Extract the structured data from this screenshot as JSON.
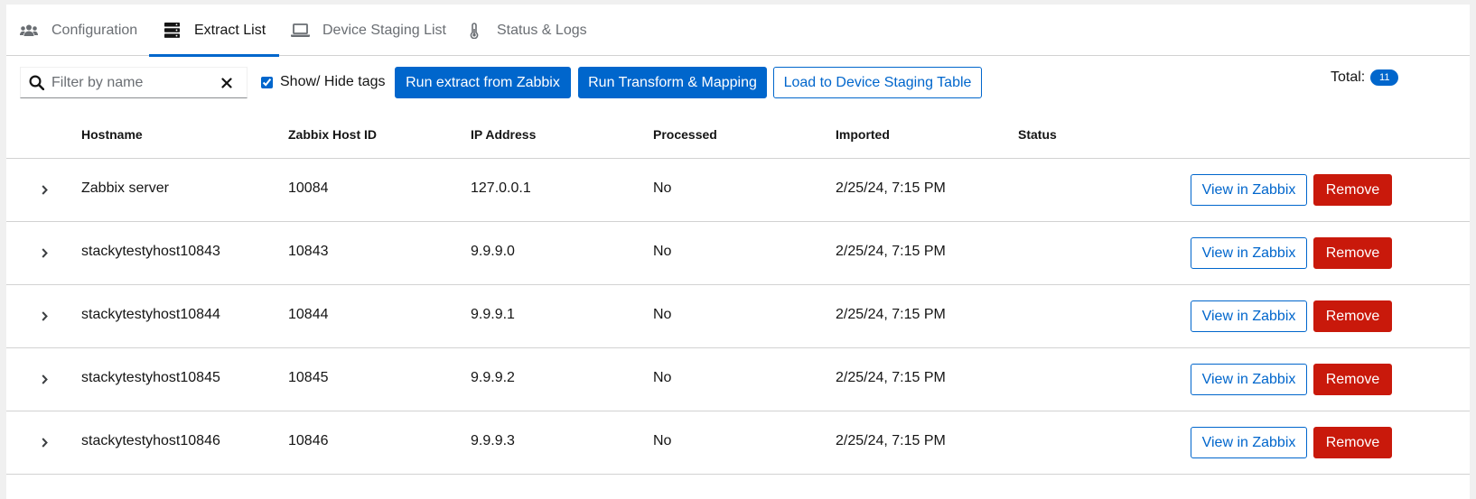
{
  "tabs": [
    {
      "label": "Configuration",
      "icon": "users-icon",
      "active": false
    },
    {
      "label": "Extract List",
      "icon": "server-icon",
      "active": true
    },
    {
      "label": "Device Staging List",
      "icon": "laptop-icon",
      "active": false
    },
    {
      "label": "Status & Logs",
      "icon": "thermometer-icon",
      "active": false
    }
  ],
  "toolbar": {
    "search_placeholder": "Filter by name",
    "search_value": "",
    "show_hide_tags_label": "Show/ Hide tags",
    "show_hide_tags_checked": true,
    "run_extract_label": "Run extract from Zabbix",
    "run_transform_label": "Run Transform & Mapping",
    "load_staging_label": "Load to Device Staging Table",
    "total_label": "Total:",
    "total_count": "11"
  },
  "table": {
    "columns": [
      "Hostname",
      "Zabbix Host ID",
      "IP Address",
      "Processed",
      "Imported",
      "Status"
    ],
    "view_label": "View in Zabbix",
    "remove_label": "Remove",
    "rows": [
      {
        "hostname": "Zabbix server",
        "host_id": "10084",
        "ip": "127.0.0.1",
        "processed": "No",
        "imported": "2/25/24, 7:15 PM",
        "status": ""
      },
      {
        "hostname": "stackytestyhost10843",
        "host_id": "10843",
        "ip": "9.9.9.0",
        "processed": "No",
        "imported": "2/25/24, 7:15 PM",
        "status": ""
      },
      {
        "hostname": "stackytestyhost10844",
        "host_id": "10844",
        "ip": "9.9.9.1",
        "processed": "No",
        "imported": "2/25/24, 7:15 PM",
        "status": ""
      },
      {
        "hostname": "stackytestyhost10845",
        "host_id": "10845",
        "ip": "9.9.9.2",
        "processed": "No",
        "imported": "2/25/24, 7:15 PM",
        "status": ""
      },
      {
        "hostname": "stackytestyhost10846",
        "host_id": "10846",
        "ip": "9.9.9.3",
        "processed": "No",
        "imported": "2/25/24, 7:15 PM",
        "status": ""
      }
    ]
  },
  "colors": {
    "primary": "#0066cc",
    "danger": "#c9190b",
    "border": "#d2d2d2",
    "muted_text": "#6a6e73"
  }
}
